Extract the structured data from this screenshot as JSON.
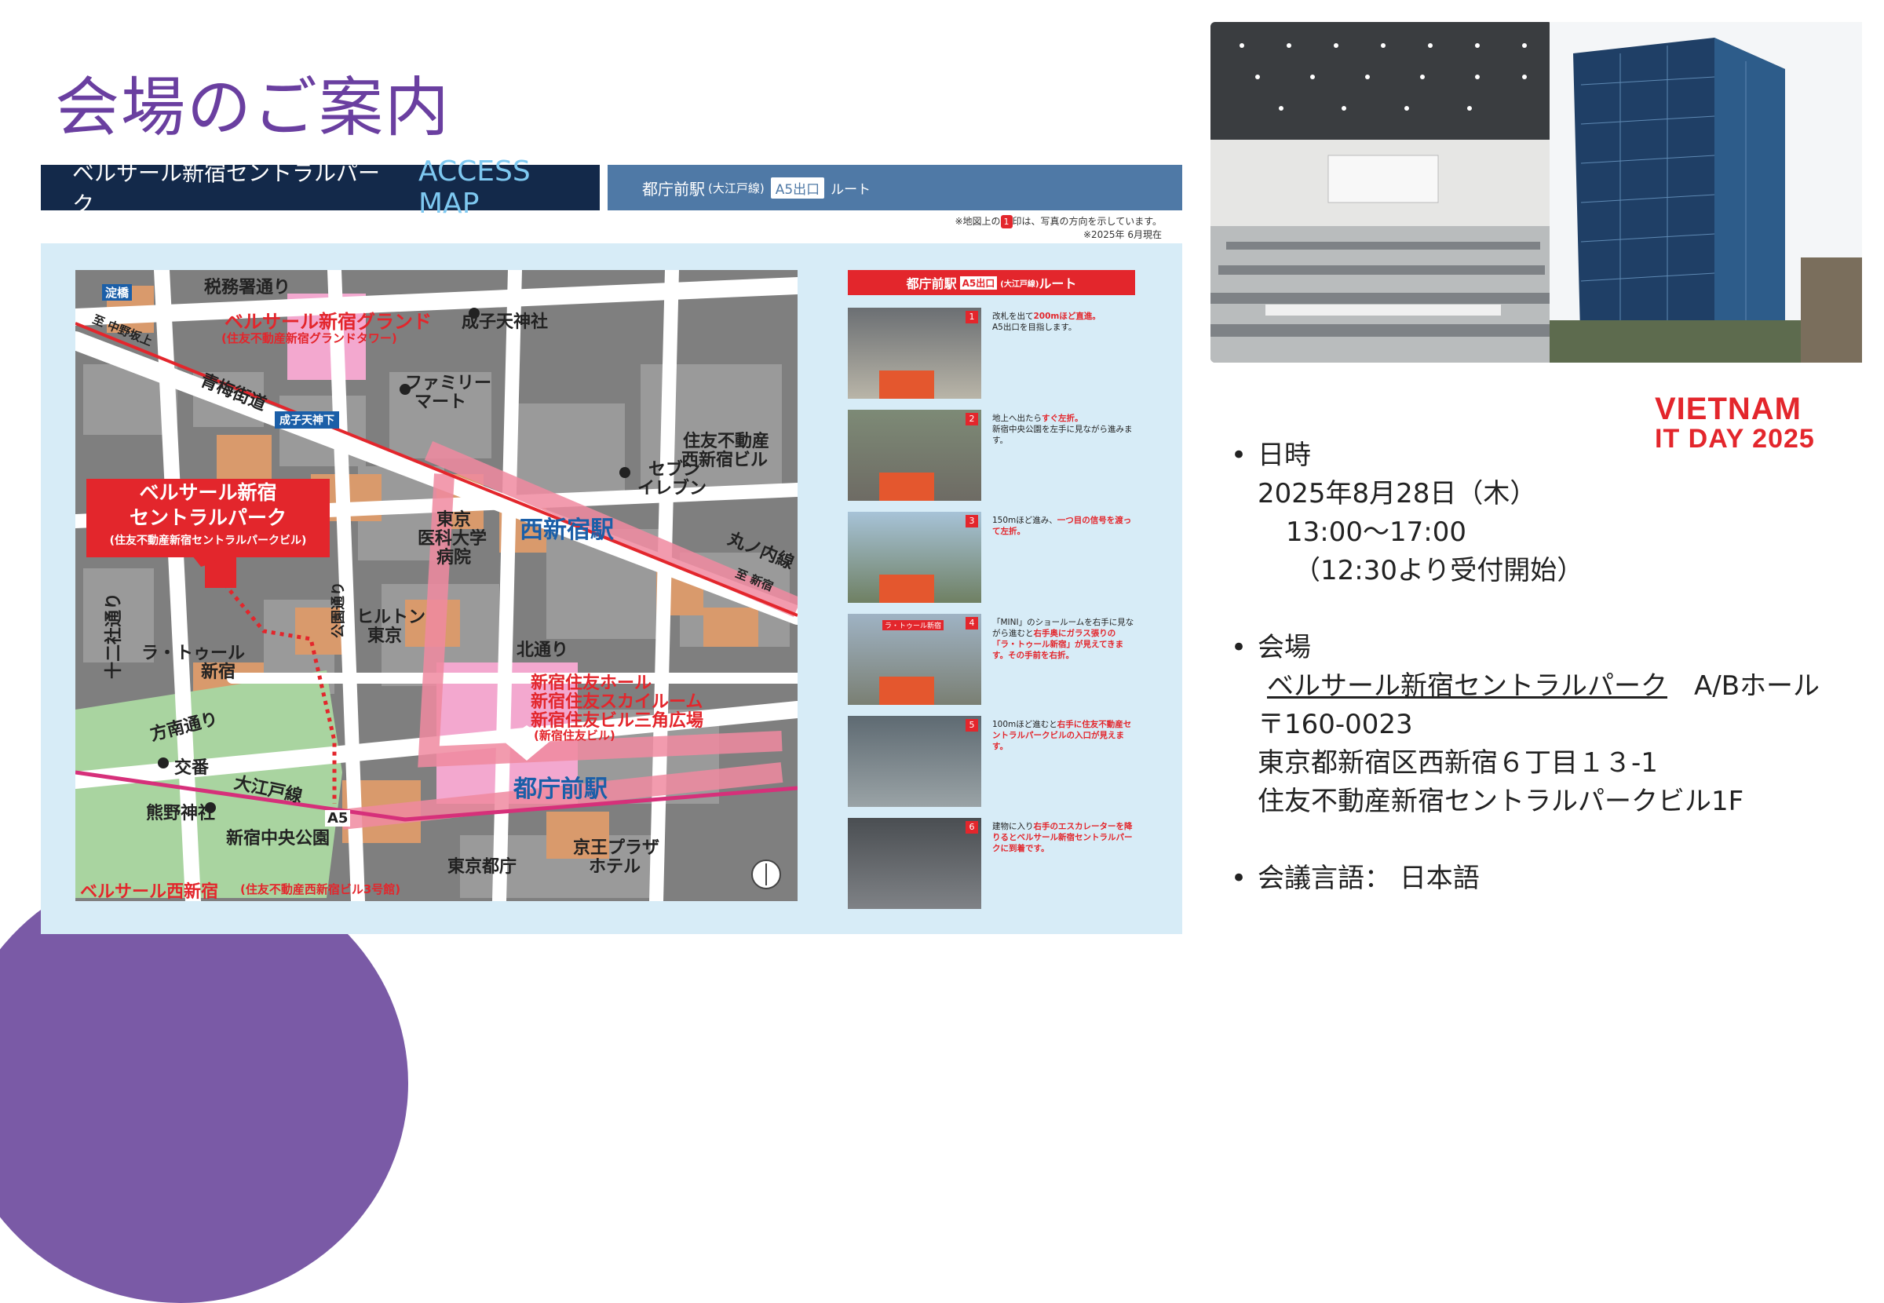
{
  "title": "会場のご案内",
  "access_bar": {
    "venue": "ベルサール新宿セントラルパーク",
    "access_map": "ACCESS MAP",
    "station": "都庁前駅",
    "line": "(大江戸線)",
    "exit": "A5出口",
    "route": "ルート"
  },
  "notes": {
    "prefix": "※地図上の",
    "badge": "1",
    "suffix": "印は、写真の方向を示しています。",
    "date": "※2025年 6月現在"
  },
  "map": {
    "labels": {
      "yodobashi": "淀橋",
      "zeimusho": "税務署通り",
      "nakano": "至 中野坂上",
      "grand": "ベルサール新宿グランド",
      "grand_sub": "(住友不動産新宿グランドタワー)",
      "narukotenjinja": "成子天神社",
      "ome": "青梅街道",
      "family1": "ファミリー",
      "family2": "マート",
      "naruko_signal": "成子天神下",
      "sumitomo_nishi1": "住友不動産",
      "sumitomo_nishi2": "西新宿ビル",
      "seven1": "セブン",
      "seven2": "イレブン",
      "tokyo_med1": "東京",
      "tokyo_med2": "医科大学",
      "tokyo_med3": "病院",
      "nishishinjuku_st": "西新宿駅",
      "marunouchi": "丸ノ内線",
      "to_shinjuku": "至 新宿",
      "callout1": "ベルサール新宿",
      "callout2": "セントラルパーク",
      "callout_sub": "(住友不動産新宿セントラルパークビル)",
      "juniso": "十二社通り",
      "latour1": "ラ・トゥール",
      "latour2": "新宿",
      "koen": "公園通り",
      "hilton1": "ヒルトン",
      "hilton2": "東京",
      "kita": "北通り",
      "sumitomo1": "新宿住友ホール",
      "sumitomo2": "新宿住友スカイルーム",
      "sumitomo3": "新宿住友ビル三角広場",
      "sumitomo_sub": "(新宿住友ビル)",
      "honan": "方南通り",
      "koban": "交番",
      "oedo": "大江戸線",
      "kumano": "熊野神社",
      "chuo_koen": "新宿中央公園",
      "tochomae_st": "都庁前駅",
      "keio1": "京王プラザ",
      "keio2": "ホテル",
      "tocho": "東京都庁",
      "nishishinjuku_bell": "ベルサール西新宿",
      "nishishinjuku_bell_sub": "(住友不動産西新宿ビル3号館)",
      "a5": "A5"
    }
  },
  "route_panel": {
    "header_station": "都庁前駅",
    "header_exit": "A5出口",
    "header_line": "(大江戸線)",
    "header_route": "ルート",
    "steps": [
      {
        "num": "1",
        "pre": "改札を出て",
        "hl": "200mほど直進。",
        "post": "A5出口を目指します。"
      },
      {
        "num": "2",
        "pre": "地上へ出たら",
        "hl": "すぐ左折。",
        "post": "新宿中央公園を左手に見ながら進みます。"
      },
      {
        "num": "3",
        "pre": "150mほど進み、",
        "hl": "一つ目の信号を渡って左折。",
        "post": ""
      },
      {
        "num": "4",
        "pre": "「MINI」のショールームを右手に見ながら進むと",
        "hl": "右手奥にガラス張りの「ラ・トゥール新宿」が見えてきます。その手前を右折。",
        "post": ""
      },
      {
        "num": "5",
        "pre": "100mほど進むと",
        "hl": "右手に住友不動産セントラルパークビルの入口が見えます。",
        "post": ""
      },
      {
        "num": "6",
        "pre": "建物に入り",
        "hl": "右手のエスカレーターを降りるとベルサール新宿セントラルパークに到着です。",
        "post": ""
      }
    ],
    "step4_tag": "ラ・トゥール新宿"
  },
  "logo": {
    "line1": "VIETNAM",
    "line2": "IT DAY 2025"
  },
  "info": {
    "date_head": "日時",
    "date": "2025年8月28日（木）",
    "time": "13:00～17:00",
    "reception": "（12:30より受付開始）",
    "venue_head": "会場",
    "venue_name": "ベルサール新宿セントラルパーク",
    "venue_hall": "A/Bホール",
    "postal": "〒160-0023",
    "address": "東京都新宿区西新宿６丁目１３-1",
    "building": "住友不動産新宿セントラルパークビル1F",
    "lang_head": "会議言語：",
    "lang": "日本語"
  },
  "colors": {
    "accent": "#6a3fa0",
    "brand_red": "#e3262c",
    "navy": "#13294a",
    "steel": "#4f79a6"
  }
}
